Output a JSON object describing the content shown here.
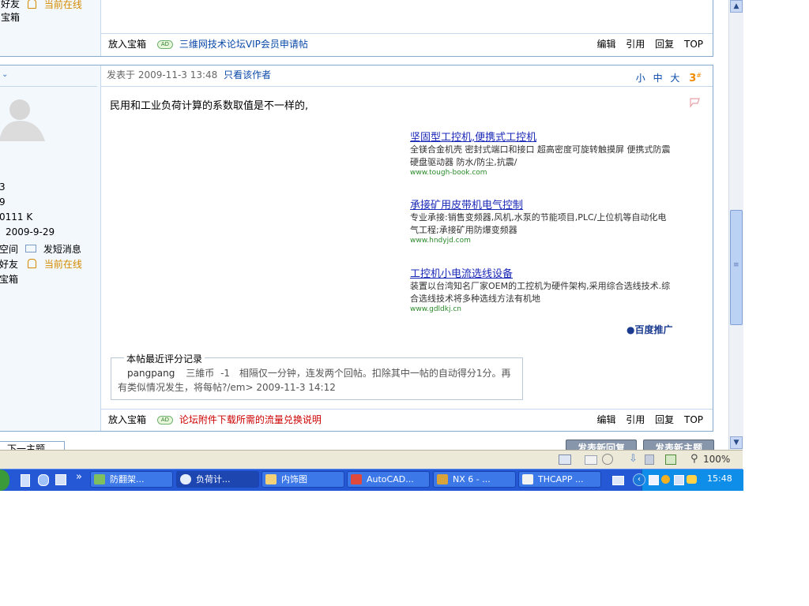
{
  "post_prev": {
    "sidebar": {
      "add_friend": "好友",
      "online_status": "当前在线",
      "treasure_box": "宝箱"
    },
    "footer": {
      "put_in_box": "放入宝箱",
      "ad_badge": "AD",
      "ad_link": "三维网技术论坛VIP会员申请帖",
      "actions": [
        "编辑",
        "引用",
        "回复",
        "TOP"
      ]
    }
  },
  "post": {
    "sidebar": {
      "chevron": "⌄",
      "stats": [
        "3",
        "9",
        "0111 K",
        "2009-9-29"
      ],
      "links": {
        "space": "空间",
        "send_msg": "发短消息",
        "add_friend": "好友",
        "online_status": "当前在线",
        "treasure_box": "宝箱"
      }
    },
    "header": {
      "posted_at": "发表于  2009-11-3 13:48",
      "only_author": "只看该作者",
      "font_sizes": [
        "小",
        "中",
        "大"
      ],
      "floor_number": "3",
      "floor_suffix": "#"
    },
    "body_text": "民用和工业负荷计算的系数取值是不一样的,",
    "ads": [
      {
        "title": "坚固型工控机,便携式工控机",
        "desc": "全镁合金机壳 密封式端口和接口 超高密度可旋转触摸屏 便携式防震硬盘驱动器 防水/防尘,抗震/",
        "url": "www.tough-book.com"
      },
      {
        "title": "承接矿用皮带机电气控制",
        "desc": "专业承接:销售变频器,风机,水泵的节能项目,PLC/上位机等自动化电气工程;承接矿用防爆变频器",
        "url": "www.hndyjd.com"
      },
      {
        "title": "工控机小电流选线设备",
        "desc": "装置以台湾知名厂家OEM的工控机为硬件架构,采用综合选线技术.综合选线技术将多种选线方法有机地",
        "url": "www.gdldkj.cn"
      }
    ],
    "baidu_promo": "百度推广",
    "rating": {
      "legend": "本帖最近评分记录",
      "user": "pangpang",
      "currency": "三維币",
      "delta": "-1",
      "reason": "相隔仅一分钟，连发两个回帖。扣除其中一帖的自动得分1分。再有类似情况发生，将每帖?/em> 2009-11-3 14:12"
    },
    "footer": {
      "put_in_box": "放入宝箱",
      "ad_badge": "AD",
      "ad_link": "论坛附件下载所需的流量兑换说明",
      "actions": [
        "编辑",
        "引用",
        "回复",
        "TOP"
      ]
    }
  },
  "bottom": {
    "prev_topic": "下一主题",
    "reply_button": "发表新回复",
    "new_topic_button": "发表新主题"
  },
  "scrollbar": {
    "up_arrow": "▲",
    "down_arrow": "▼",
    "grip": "≡"
  },
  "statusbar": {
    "zoom": "100%"
  },
  "taskbar": {
    "tasks": [
      {
        "label": "防翻架..."
      },
      {
        "label": "负荷计..."
      },
      {
        "label": "内饰图"
      },
      {
        "label": "AutoCAD..."
      },
      {
        "label": "NX 6 - ..."
      },
      {
        "label": "THCAPP ..."
      }
    ],
    "chevron": "»",
    "clock": "15:48"
  },
  "colors": {
    "border": "#86a9cc",
    "sidebar_bg": "#f3f8fd",
    "link_blue": "#0a48a8",
    "online_orange": "#d38a00",
    "ad_red": "#cc0000",
    "floor_orange": "#f08a00",
    "taskbar_blue": "#2458d4",
    "tray_blue": "#0f8ee9"
  }
}
